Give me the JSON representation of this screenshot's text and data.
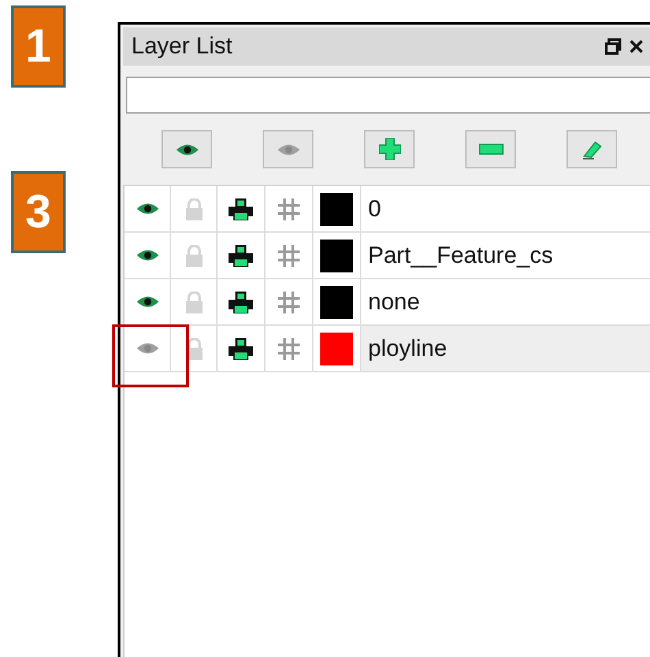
{
  "step_badges": [
    "1",
    "3"
  ],
  "panel": {
    "title": "Layer List"
  },
  "layers": [
    {
      "name": "0",
      "visible": true,
      "color": "#000000",
      "selected": false,
      "highlighted": false
    },
    {
      "name": "Part__Feature_cs",
      "visible": true,
      "color": "#000000",
      "selected": false,
      "highlighted": false
    },
    {
      "name": "none",
      "visible": true,
      "color": "#000000",
      "selected": false,
      "highlighted": false
    },
    {
      "name": "ployline",
      "visible": false,
      "color": "#ff0000",
      "selected": true,
      "highlighted": true
    }
  ]
}
